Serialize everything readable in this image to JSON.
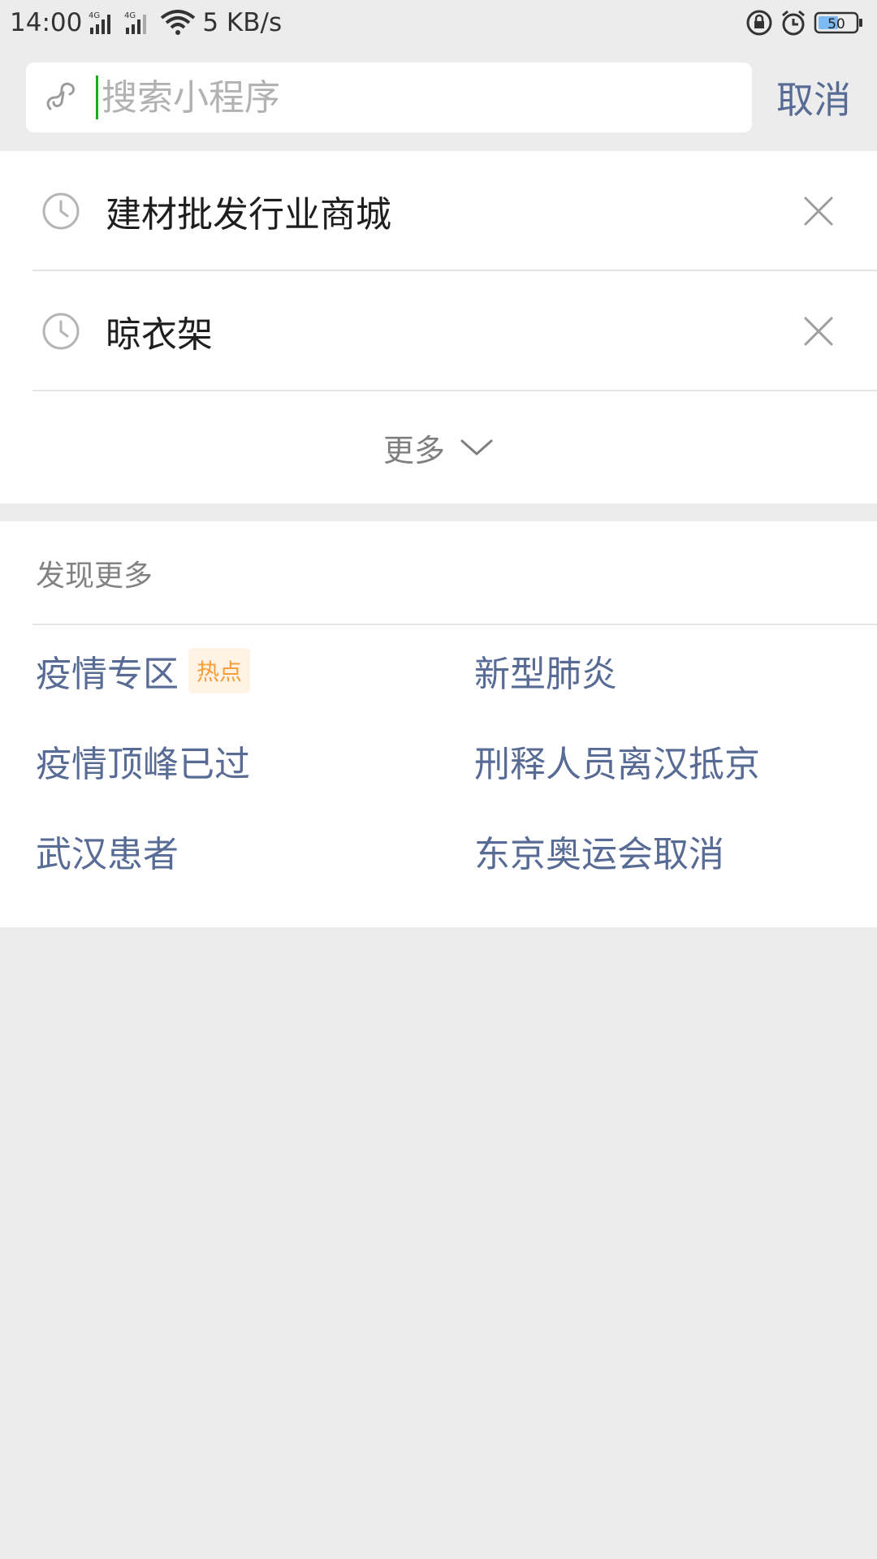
{
  "status_bar": {
    "time": "14:00",
    "net_type_1": "4G",
    "net_type_2": "4G",
    "speed": "5 KB/s",
    "battery": "50"
  },
  "search": {
    "placeholder": "搜索小程序",
    "value": "",
    "cancel_label": "取消"
  },
  "history": {
    "items": [
      {
        "label": "建材批发行业商城"
      },
      {
        "label": "晾衣架"
      }
    ],
    "more_label": "更多"
  },
  "discover": {
    "title": "发现更多",
    "topics": [
      {
        "label": "疫情专区",
        "badge": "热点"
      },
      {
        "label": "新型肺炎"
      },
      {
        "label": "疫情顶峰已过"
      },
      {
        "label": "刑释人员离汉抵京"
      },
      {
        "label": "武汉患者"
      },
      {
        "label": "东京奥运会取消"
      }
    ]
  },
  "colors": {
    "link": "#576b95",
    "caret": "#1aad19",
    "badge_text": "#fa9d3b",
    "badge_bg": "#fff3e6",
    "page_bg": "#ececed"
  },
  "icons": {
    "mini_program": "mini-program-icon",
    "history": "clock-icon",
    "delete": "close-icon",
    "expand": "chevron-down-icon"
  }
}
